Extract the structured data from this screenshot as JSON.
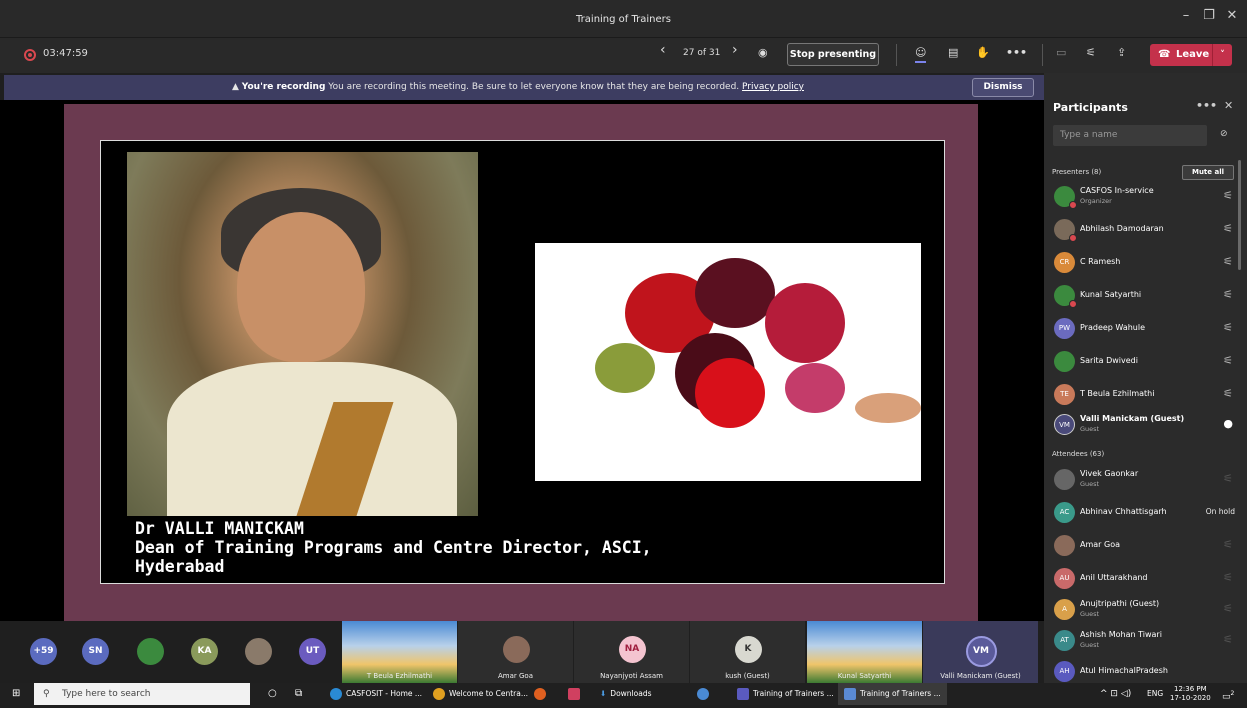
{
  "window": {
    "title": "Training of Trainers"
  },
  "toolbar": {
    "timer": "03:47:59",
    "page": "27 of 31",
    "stop": "Stop presenting",
    "leave": "Leave"
  },
  "banner": {
    "heading": "You're recording",
    "text": "You are recording this meeting. Be sure to let everyone know that they are being recorded.",
    "link": "Privacy policy",
    "dismiss": "Dismiss"
  },
  "slide": {
    "line1": "Dr VALLI MANICKAM",
    "line2": "Dean of Training Programs and Centre Director, ASCI,",
    "line3": "Hyderabad"
  },
  "gallery": {
    "more": "+59",
    "avatars": [
      {
        "initials": "SN",
        "color": "#5b6bbf"
      },
      {
        "initials": "",
        "color": "#3b8a3e"
      },
      {
        "initials": "KA",
        "color": "#8a9a5b"
      },
      {
        "initials": "",
        "color": "#8a7a6a"
      },
      {
        "initials": "UT",
        "color": "#6b5bbf"
      }
    ],
    "tiles": [
      {
        "name": "T Beula Ezhilmathi"
      },
      {
        "name": "Amar Goa"
      },
      {
        "name": "Nayanjyoti Assam",
        "initials": "NA"
      },
      {
        "name": "kush (Guest)",
        "initials": "K"
      },
      {
        "name": "Kunal Satyarthi"
      },
      {
        "name": "Valli Manickam (Guest)",
        "initials": "VM"
      }
    ]
  },
  "participants": {
    "title": "Participants",
    "search_placeholder": "Type a name",
    "presenters_label": "Presenters (8)",
    "mute_all": "Mute all",
    "presenters": [
      {
        "initials": "",
        "name": "CASFOS In-service",
        "role": "Organizer",
        "color": "#3b8a3e"
      },
      {
        "initials": "",
        "name": "Abhilash Damodaran",
        "role": "",
        "color": "#7a6a5a"
      },
      {
        "initials": "CR",
        "name": "C Ramesh",
        "role": "",
        "color": "#d98a3a"
      },
      {
        "initials": "",
        "name": "Kunal Satyarthi",
        "role": "",
        "color": "#3b8a3e"
      },
      {
        "initials": "PW",
        "name": "Pradeep Wahule",
        "role": "",
        "color": "#6b6bbf"
      },
      {
        "initials": "",
        "name": "Sarita Dwivedi",
        "role": "",
        "color": "#3b8a3e"
      },
      {
        "initials": "TE",
        "name": "T Beula Ezhilmathi",
        "role": "",
        "color": "#c97a5a"
      },
      {
        "initials": "VM",
        "name": "Valli Manickam (Guest)",
        "role": "Guest",
        "color": "#4a4a7a"
      }
    ],
    "attendees_label": "Attendees (63)",
    "attendees": [
      {
        "initials": "",
        "name": "Vivek Gaonkar",
        "role": "Guest",
        "color": "#666666",
        "status": ""
      },
      {
        "initials": "AC",
        "name": "Abhinav Chhattisgarh",
        "role": "",
        "color": "#3a9a8a",
        "status": "On hold"
      },
      {
        "initials": "",
        "name": "Amar Goa",
        "role": "",
        "color": "#8a6a5a",
        "status": ""
      },
      {
        "initials": "AU",
        "name": "Anil Uttarakhand",
        "role": "",
        "color": "#c96a6a",
        "status": ""
      },
      {
        "initials": "A",
        "name": "Anujtripathi (Guest)",
        "role": "Guest",
        "color": "#d9a04a",
        "status": ""
      },
      {
        "initials": "AT",
        "name": "Ashish Mohan Tiwari",
        "role": "Guest",
        "color": "#3a8a8a",
        "status": ""
      },
      {
        "initials": "AH",
        "name": "Atul HimachalPradesh",
        "role": "",
        "color": "#5a5abf",
        "status": ""
      }
    ]
  },
  "taskbar": {
    "search": "Type here to search",
    "items": [
      "CASFOSIT - Home ...",
      "Welcome to Centra...",
      "Downloads",
      "Training of Trainers ...",
      "Training of Trainers ..."
    ],
    "lang": "ENG",
    "time": "12:36 PM",
    "date": "17-10-2020",
    "notif": "2"
  }
}
